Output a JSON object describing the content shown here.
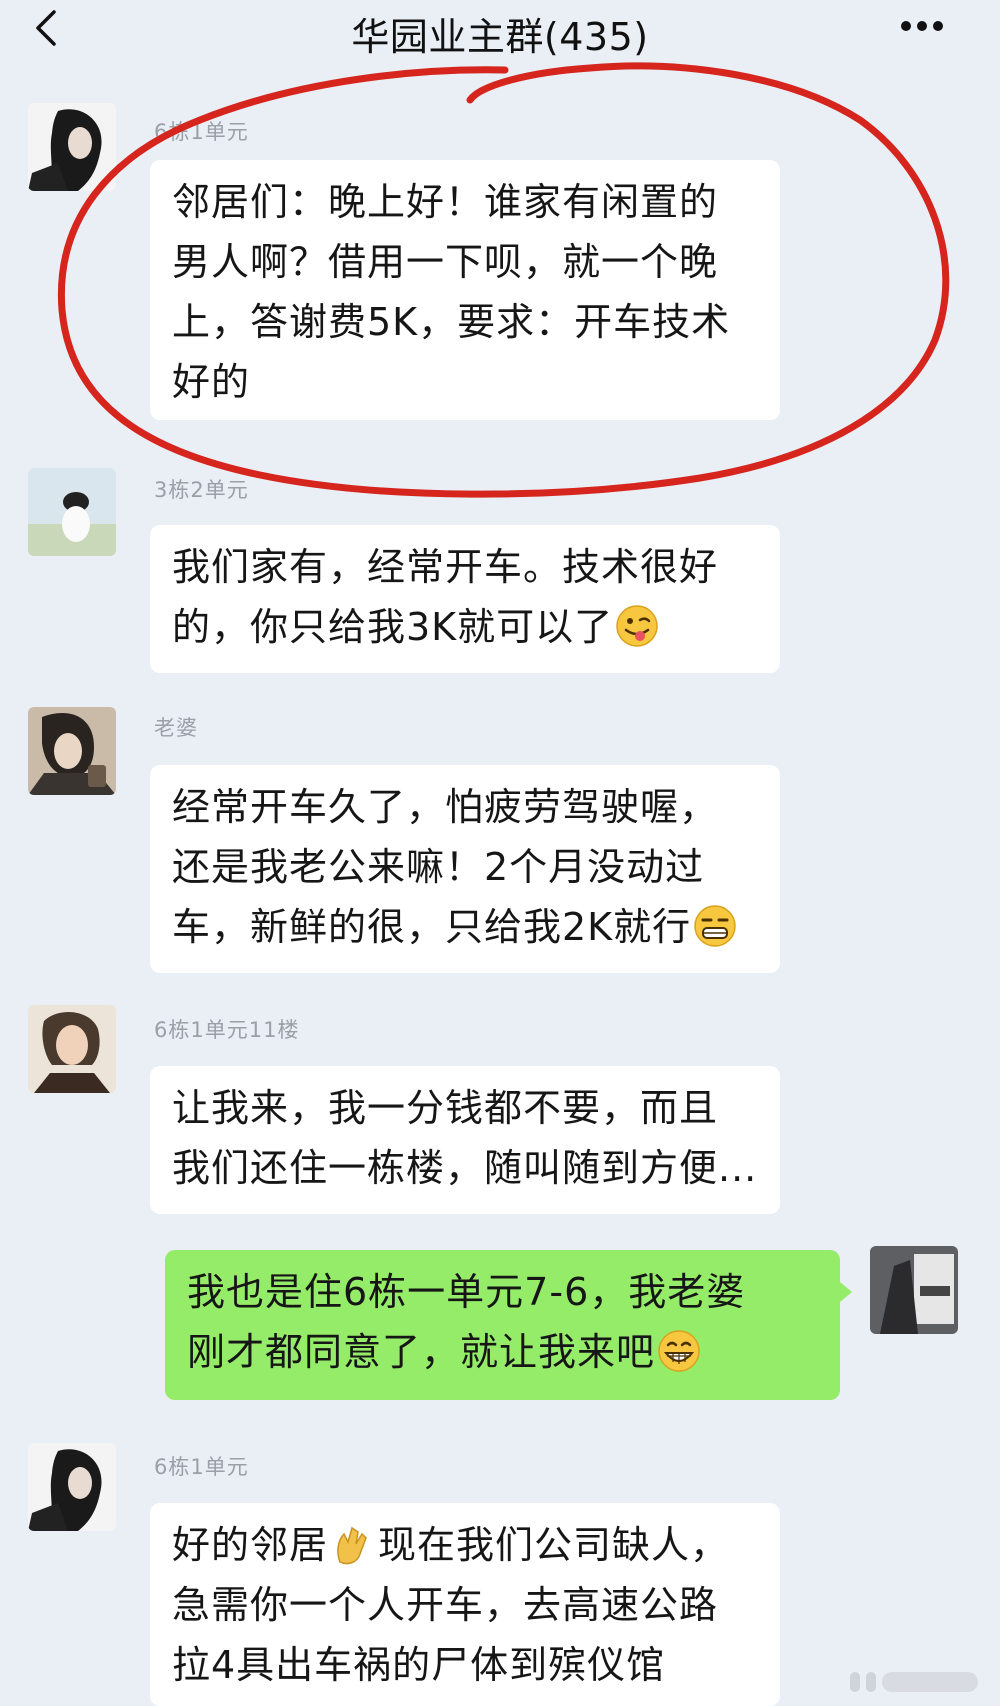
{
  "header": {
    "title": "华园业主群(435)",
    "back_icon": "chevron-left-icon",
    "more_icon": "more-dots-icon"
  },
  "messages": [
    {
      "sender": "6栋1单元",
      "lines": [
        "邻居们：晚上好！谁家有闲置的",
        "男人啊？借用一下呗，就一个晚",
        "上，答谢费5K，要求：开车技术",
        "好的"
      ],
      "emoji": ""
    },
    {
      "sender": "3栋2单元",
      "lines": [
        "我们家有，经常开车。技术很好",
        "的，你只给我3K就可以了"
      ],
      "emoji": "tongue-out-emoji"
    },
    {
      "sender": "老婆",
      "lines": [
        "经常开车久了，怕疲劳驾驶喔，",
        "还是我老公来嘛！2个月没动过",
        "车，新鲜的很，只给我2K就行"
      ],
      "emoji": "grimace-emoji"
    },
    {
      "sender": "6栋1单元11楼",
      "lines": [
        "让我来，我一分钱都不要，而且",
        "我们还住一栋楼，随叫随到方便..."
      ],
      "emoji": ""
    },
    {
      "sender": "",
      "lines": [
        "我也是住6栋一单元7-6，我老婆",
        "刚才都同意了，就让我来吧"
      ],
      "emoji": "grin-emoji",
      "mine": true
    },
    {
      "sender": "6栋1单元",
      "lines": [
        "好的邻居",
        "急需你一个人开车，去高速公路",
        "拉4具出车祸的尸体到殡仪馆"
      ],
      "line1_suffix": "现在我们公司缺人，",
      "emoji": "clap-emoji"
    }
  ],
  "annotation": {
    "color": "#d6251d"
  },
  "colors": {
    "background": "#eaeef5",
    "bubble_other": "#ffffff",
    "bubble_mine": "#95ec69"
  }
}
